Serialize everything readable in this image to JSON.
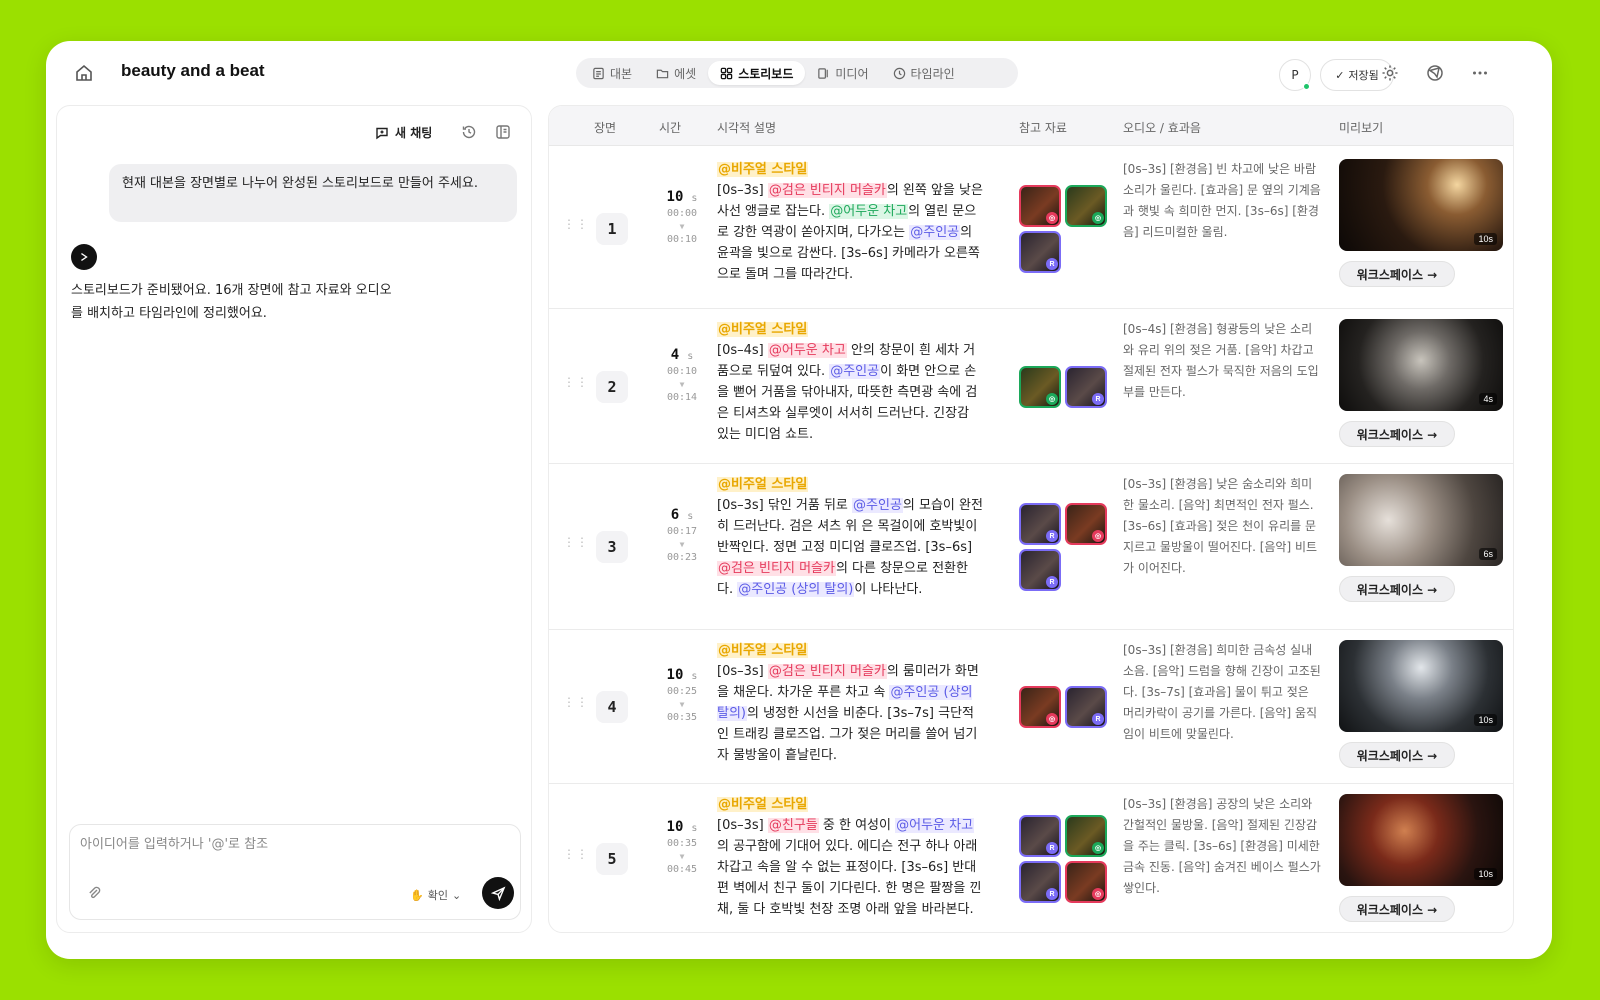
{
  "header": {
    "title": "beauty and a beat",
    "tabs": [
      {
        "label": "대본",
        "icon": "script-icon"
      },
      {
        "label": "에셋",
        "icon": "folder-icon"
      },
      {
        "label": "스토리보드",
        "icon": "grid-icon"
      },
      {
        "label": "미디어",
        "icon": "media-icon"
      },
      {
        "label": "타임라인",
        "icon": "clock-icon"
      }
    ],
    "active_tab": "스토리보드",
    "avatar_initial": "P",
    "saved_label": "저장됨"
  },
  "chat": {
    "new_chat_label": "새 채팅",
    "user_message": "현재 대본을 장면별로 나누어 완성된 스토리보드로 만들어 주세요.",
    "assistant_message": "스토리보드가 준비됐어요. 16개 장면에 참고 자료와 오디오를 배치하고 타임라인에 정리했어요.",
    "input_placeholder": "아이디어를 입력하거나 '@'로 참조",
    "confirm_label": "확인"
  },
  "table": {
    "headers": [
      "장면",
      "시간",
      "시각적 설명",
      "참고 자료",
      "오디오 / 효과음",
      "미리보기"
    ],
    "workspace_label": "워크스페이스 →",
    "rows": [
      {
        "scene": "1",
        "seconds": "10",
        "unit": "s",
        "start": "00:00",
        "end": "00:10",
        "style_tag": "@비주얼 스타일",
        "desc": [
          {
            "t": "[0s–3s] "
          },
          {
            "t": "@검은 빈티지 머슬카",
            "k": "car"
          },
          {
            "t": "의 왼쪽 앞을 낮은 사선 앵글로 잡는다. "
          },
          {
            "t": "@어두운 차고",
            "k": "env"
          },
          {
            "t": "의 열린 문으로 강한 역광이 쏟아지며, 다가오는 "
          },
          {
            "t": "@주인공",
            "k": "person"
          },
          {
            "t": "의 윤곽을 빛으로 감싼다. [3s–6s] 카메라가 오른쪽으로 돌며 그를 따라간다."
          }
        ],
        "refs": [
          "car",
          "env",
          "person"
        ],
        "audio": "[0s–3s] [환경음] 빈 차고에 낮은 바람 소리가 울린다. [효과음] 문 옆의 기계음과 햇빛 속 희미한 먼지. [3s–6s] [환경음] 리드미컬한 울림.",
        "preview_duration": "10s"
      },
      {
        "scene": "2",
        "seconds": "4",
        "unit": "s",
        "start": "00:10",
        "end": "00:14",
        "style_tag": "@비주얼 스타일",
        "desc": [
          {
            "t": "[0s–4s] "
          },
          {
            "t": "@어두운 차고",
            "k": "car"
          },
          {
            "t": " 안의 창문이 흰 세차 거품으로 뒤덮여 있다. "
          },
          {
            "t": "@주인공",
            "k": "person"
          },
          {
            "t": "이 화면 안으로 손을 뻗어 거품을 닦아내자, 따뜻한 측면광 속에 검은 티셔츠와 실루엣이 서서히 드러난다. 긴장감 있는 미디엄 쇼트."
          }
        ],
        "refs": [
          "env",
          "person"
        ],
        "audio": "[0s–4s] [환경음] 형광등의 낮은 소리와 유리 위의 젖은 거품. [음악] 차갑고 절제된 전자 펄스가 묵직한 저음의 도입부를 만든다.",
        "preview_duration": "4s"
      },
      {
        "scene": "3",
        "seconds": "6",
        "unit": "s",
        "start": "00:17",
        "end": "00:23",
        "style_tag": "@비주얼 스타일",
        "desc": [
          {
            "t": "[0s–3s] 닦인 거품 뒤로 "
          },
          {
            "t": "@주인공",
            "k": "person"
          },
          {
            "t": "의 모습이 완전히 드러난다. 검은 셔츠 위 은 목걸이에 호박빛이 반짝인다. 정면 고정 미디엄 클로즈업. [3s–6s] "
          },
          {
            "t": "@검은 빈티지 머슬카",
            "k": "car"
          },
          {
            "t": "의 다른 창문으로 전환한다. "
          },
          {
            "t": "@주인공 (상의 탈의)",
            "k": "person"
          },
          {
            "t": "이 나타난다."
          }
        ],
        "refs": [
          "person",
          "car",
          "person"
        ],
        "audio": "[0s–3s] [환경음] 낮은 숨소리와 희미한 물소리. [음악] 최면적인 전자 펄스. [3s–6s] [효과음] 젖은 천이 유리를 문지르고 물방울이 떨어진다. [음악] 비트가 이어진다.",
        "preview_duration": "6s"
      },
      {
        "scene": "4",
        "seconds": "10",
        "unit": "s",
        "start": "00:25",
        "end": "00:35",
        "style_tag": "@비주얼 스타일",
        "desc": [
          {
            "t": "[0s–3s] "
          },
          {
            "t": "@검은 빈티지 머슬카",
            "k": "car"
          },
          {
            "t": "의 룸미러가 화면을 채운다. 차가운 푸른 차고 속 "
          },
          {
            "t": "@주인공 (상의 탈의)",
            "k": "person"
          },
          {
            "t": "의 냉정한 시선을 비춘다. [3s–7s] 극단적인 트래킹 클로즈업. 그가 젖은 머리를 쓸어 넘기자 물방울이 흩날린다."
          }
        ],
        "refs": [
          "car",
          "person"
        ],
        "audio": "[0s–3s] [환경음] 희미한 금속성 실내 소음. [음악] 드럼을 향해 긴장이 고조된다. [3s–7s] [효과음] 물이 튀고 젖은 머리카락이 공기를 가른다. [음악] 움직임이 비트에 맞물린다.",
        "preview_duration": "10s"
      },
      {
        "scene": "5",
        "seconds": "10",
        "unit": "s",
        "start": "00:35",
        "end": "00:45",
        "style_tag": "@비주얼 스타일",
        "desc": [
          {
            "t": "[0s–3s] "
          },
          {
            "t": "@친구들",
            "k": "car"
          },
          {
            "t": " 중 한 여성이 "
          },
          {
            "t": "@어두운 차고",
            "k": "person"
          },
          {
            "t": "의 공구함에 기대어 있다. 에디슨 전구 하나 아래 차갑고 속을 알 수 없는 표정이다. [3s–6s] 반대편 벽에서 친구 둘이 기다린다. 한 명은 팔짱을 낀 채, 둘 다 호박빛 천장 조명 아래 앞을 바라본다."
          }
        ],
        "refs": [
          "person",
          "env",
          "person",
          "car"
        ],
        "audio": "[0s–3s] [환경음] 공장의 낮은 소리와 간헐적인 물방울. [음악] 절제된 긴장감을 주는 클릭. [3s–6s] [환경음] 미세한 금속 진동. [음악] 숨겨진 베이스 펄스가 쌓인다.",
        "preview_duration": "10s"
      }
    ]
  },
  "colors": {
    "background": "#9be000",
    "style_tag": "#e8a700",
    "car_tag": "#e53a5c",
    "env_tag": "#1ca85a",
    "person_tag": "#5b5be6"
  }
}
